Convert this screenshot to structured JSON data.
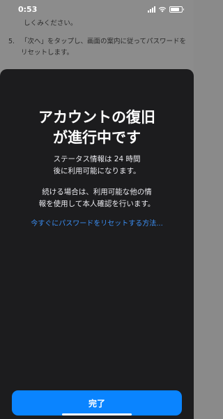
{
  "status_bar": {
    "time": "0:53",
    "icons": [
      "cellular-signal-icon",
      "wifi-icon",
      "battery-icon"
    ]
  },
  "background_doc": {
    "line_top": "しくみください。",
    "step_number": "5.",
    "step_text": "「次へ」をタップし、画面の案内に従ってパスワードをリセットします。"
  },
  "sheet": {
    "title_line1": "アカウントの復旧",
    "title_line2": "が進行中です",
    "desc1_line1": "ステータス情報は 24 時間",
    "desc1_line2": "後に利用可能になります。",
    "desc2_line1": "続ける場合は、利用可能な他の情",
    "desc2_line2": "報を使用して本人確認を行います。",
    "link_text": "今すぐにパスワードをリセットする方法...",
    "done_label": "完了"
  },
  "colors": {
    "sheet_bg": "#1c1c1e",
    "accent": "#0a84ff",
    "link": "#3b8ff5"
  }
}
